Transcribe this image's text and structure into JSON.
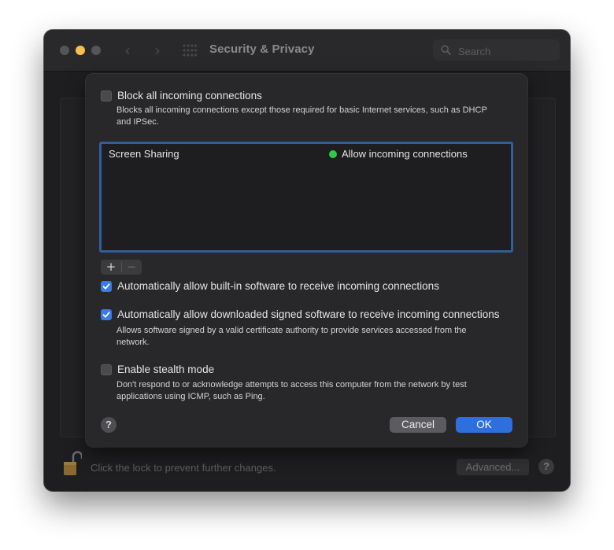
{
  "window": {
    "title": "Security & Privacy",
    "search_placeholder": "Search",
    "footer_text": "Click the lock to prevent further changes.",
    "advanced_label": "Advanced...",
    "help_label": "?"
  },
  "sheet": {
    "block_all": {
      "label": "Block all incoming connections",
      "checked": false,
      "description": "Blocks all incoming connections except those required for basic Internet services, such as DHCP and IPSec."
    },
    "apps": [
      {
        "name": "Screen Sharing",
        "status": "Allow incoming connections",
        "status_color": "#33c748"
      }
    ],
    "add_label": "+",
    "remove_label": "−",
    "auto_builtin": {
      "label": "Automatically allow built-in software to receive incoming connections",
      "checked": true
    },
    "auto_signed": {
      "label": "Automatically allow downloaded signed software to receive incoming connections",
      "checked": true,
      "description": "Allows software signed by a valid certificate authority to provide services accessed from the network."
    },
    "stealth": {
      "label": "Enable stealth mode",
      "checked": false,
      "description": "Don't respond to or acknowledge attempts to access this computer from the network by test applications using ICMP, such as Ping."
    },
    "help_label": "?",
    "cancel_label": "Cancel",
    "ok_label": "OK"
  },
  "colors": {
    "accent": "#2f6fdc",
    "checkbox_on": "#3a7ce4",
    "status_green": "#33c748",
    "traffic_yellow": "#f4bf4f"
  },
  "icons": {
    "back": "chevron-left-icon",
    "forward": "chevron-right-icon",
    "grid": "grid-icon",
    "search": "search-icon",
    "lock": "unlocked-padlock-icon",
    "help": "help-icon"
  }
}
